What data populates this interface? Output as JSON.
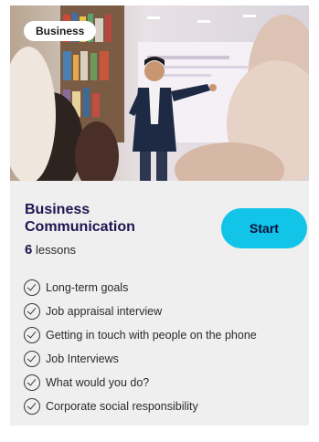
{
  "course": {
    "category": "Business",
    "title": "Business Communication",
    "lesson_count": "6",
    "lesson_unit": "lessons",
    "start_label": "Start",
    "lessons": [
      "Long-term goals",
      "Job appraisal interview",
      "Getting in touch with people on the phone",
      "Job Interviews",
      "What would you do?",
      "Corporate social responsibility"
    ]
  },
  "colors": {
    "title": "#1f1552",
    "start_button": "#11c4e8",
    "card_background": "#efefef"
  }
}
